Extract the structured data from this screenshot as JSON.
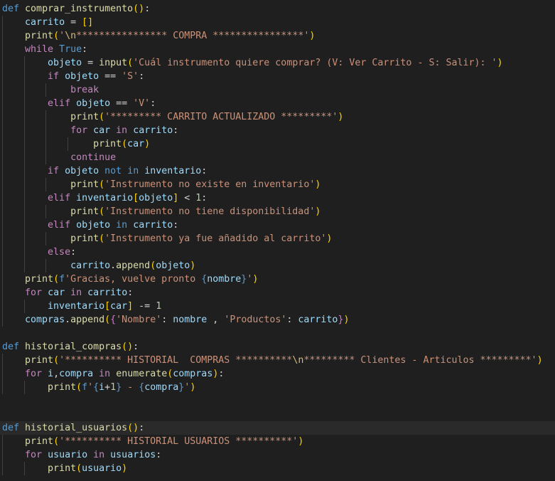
{
  "theme": {
    "background": "#1f1f1f",
    "current_line": "#2a2a2a",
    "indent_guide": "#404040",
    "colors": {
      "kw": "#569cd6",
      "ctl": "#c586c0",
      "fn": "#dcdcaa",
      "var": "#9cdcfe",
      "str": "#ce9178",
      "num": "#b5cea8",
      "op": "#d4d4d4",
      "b1": "#ffd700",
      "b2": "#da70d6",
      "b3": "#179fff",
      "esc": "#d7ba7d"
    }
  },
  "editor": {
    "lines": [
      {
        "indent": 0,
        "tokens": [
          [
            "def",
            "kw"
          ],
          [
            " ",
            "op"
          ],
          [
            "comprar_instrumento",
            "fn"
          ],
          [
            "(",
            "b1"
          ],
          [
            ")",
            "b1"
          ],
          [
            ":",
            "op"
          ]
        ]
      },
      {
        "indent": 1,
        "tokens": [
          [
            "carrito",
            "var"
          ],
          [
            " = ",
            "op"
          ],
          [
            "[",
            "b1"
          ],
          [
            "]",
            "b1"
          ]
        ]
      },
      {
        "indent": 1,
        "tokens": [
          [
            "print",
            "fn"
          ],
          [
            "(",
            "b1"
          ],
          [
            "'",
            "str"
          ],
          [
            "\\n",
            "esc"
          ],
          [
            "**************** COMPRA ****************'",
            "str"
          ],
          [
            ")",
            "b1"
          ]
        ]
      },
      {
        "indent": 1,
        "tokens": [
          [
            "while",
            "ctl"
          ],
          [
            " ",
            "op"
          ],
          [
            "True",
            "kw"
          ],
          [
            ":",
            "op"
          ]
        ]
      },
      {
        "indent": 2,
        "tokens": [
          [
            "objeto",
            "var"
          ],
          [
            " = ",
            "op"
          ],
          [
            "input",
            "fn"
          ],
          [
            "(",
            "b1"
          ],
          [
            "'Cuál instrumento quiere comprar? (V: Ver Carrito - S: Salir): '",
            "str"
          ],
          [
            ")",
            "b1"
          ]
        ]
      },
      {
        "indent": 2,
        "tokens": [
          [
            "if",
            "ctl"
          ],
          [
            " ",
            "op"
          ],
          [
            "objeto",
            "var"
          ],
          [
            " == ",
            "op"
          ],
          [
            "'S'",
            "str"
          ],
          [
            ":",
            "op"
          ]
        ]
      },
      {
        "indent": 3,
        "tokens": [
          [
            "break",
            "ctl"
          ]
        ]
      },
      {
        "indent": 2,
        "tokens": [
          [
            "elif",
            "ctl"
          ],
          [
            " ",
            "op"
          ],
          [
            "objeto",
            "var"
          ],
          [
            " == ",
            "op"
          ],
          [
            "'V'",
            "str"
          ],
          [
            ":",
            "op"
          ]
        ]
      },
      {
        "indent": 3,
        "tokens": [
          [
            "print",
            "fn"
          ],
          [
            "(",
            "b1"
          ],
          [
            "'********* CARRITO ACTUALIZADO *********'",
            "str"
          ],
          [
            ")",
            "b1"
          ]
        ]
      },
      {
        "indent": 3,
        "tokens": [
          [
            "for",
            "ctl"
          ],
          [
            " ",
            "op"
          ],
          [
            "car",
            "var"
          ],
          [
            " ",
            "op"
          ],
          [
            "in",
            "ctl"
          ],
          [
            " ",
            "op"
          ],
          [
            "carrito",
            "var"
          ],
          [
            ":",
            "op"
          ]
        ]
      },
      {
        "indent": 4,
        "tokens": [
          [
            "print",
            "fn"
          ],
          [
            "(",
            "b1"
          ],
          [
            "car",
            "var"
          ],
          [
            ")",
            "b1"
          ]
        ]
      },
      {
        "indent": 3,
        "tokens": [
          [
            "continue",
            "ctl"
          ]
        ]
      },
      {
        "indent": 2,
        "tokens": [
          [
            "if",
            "ctl"
          ],
          [
            " ",
            "op"
          ],
          [
            "objeto",
            "var"
          ],
          [
            " ",
            "op"
          ],
          [
            "not",
            "kw"
          ],
          [
            " ",
            "op"
          ],
          [
            "in",
            "kw"
          ],
          [
            " ",
            "op"
          ],
          [
            "inventario",
            "var"
          ],
          [
            ":",
            "op"
          ]
        ]
      },
      {
        "indent": 3,
        "tokens": [
          [
            "print",
            "fn"
          ],
          [
            "(",
            "b1"
          ],
          [
            "'Instrumento no existe en inventario'",
            "str"
          ],
          [
            ")",
            "b1"
          ]
        ]
      },
      {
        "indent": 2,
        "tokens": [
          [
            "elif",
            "ctl"
          ],
          [
            " ",
            "op"
          ],
          [
            "inventario",
            "var"
          ],
          [
            "[",
            "b1"
          ],
          [
            "objeto",
            "var"
          ],
          [
            "]",
            "b1"
          ],
          [
            " < ",
            "op"
          ],
          [
            "1",
            "num"
          ],
          [
            ":",
            "op"
          ]
        ]
      },
      {
        "indent": 3,
        "tokens": [
          [
            "print",
            "fn"
          ],
          [
            "(",
            "b1"
          ],
          [
            "'Instrumento no tiene disponibilidad'",
            "str"
          ],
          [
            ")",
            "b1"
          ]
        ]
      },
      {
        "indent": 2,
        "tokens": [
          [
            "elif",
            "ctl"
          ],
          [
            " ",
            "op"
          ],
          [
            "objeto",
            "var"
          ],
          [
            " ",
            "op"
          ],
          [
            "in",
            "kw"
          ],
          [
            " ",
            "op"
          ],
          [
            "carrito",
            "var"
          ],
          [
            ":",
            "op"
          ]
        ]
      },
      {
        "indent": 3,
        "tokens": [
          [
            "print",
            "fn"
          ],
          [
            "(",
            "b1"
          ],
          [
            "'Instrumento ya fue añadido al carrito'",
            "str"
          ],
          [
            ")",
            "b1"
          ]
        ]
      },
      {
        "indent": 2,
        "tokens": [
          [
            "else",
            "ctl"
          ],
          [
            ":",
            "op"
          ]
        ]
      },
      {
        "indent": 3,
        "tokens": [
          [
            "carrito",
            "var"
          ],
          [
            ".",
            "op"
          ],
          [
            "append",
            "fn"
          ],
          [
            "(",
            "b1"
          ],
          [
            "objeto",
            "var"
          ],
          [
            ")",
            "b1"
          ]
        ]
      },
      {
        "indent": 1,
        "tokens": [
          [
            "print",
            "fn"
          ],
          [
            "(",
            "b1"
          ],
          [
            "f",
            "kw"
          ],
          [
            "'Gracias, vuelve pronto ",
            "str"
          ],
          [
            "{",
            "kw"
          ],
          [
            "nombre",
            "var"
          ],
          [
            "}",
            "kw"
          ],
          [
            "'",
            "str"
          ],
          [
            ")",
            "b1"
          ]
        ]
      },
      {
        "indent": 1,
        "tokens": [
          [
            "for",
            "ctl"
          ],
          [
            " ",
            "op"
          ],
          [
            "car",
            "var"
          ],
          [
            " ",
            "op"
          ],
          [
            "in",
            "ctl"
          ],
          [
            " ",
            "op"
          ],
          [
            "carrito",
            "var"
          ],
          [
            ":",
            "op"
          ]
        ]
      },
      {
        "indent": 2,
        "tokens": [
          [
            "inventario",
            "var"
          ],
          [
            "[",
            "b1"
          ],
          [
            "car",
            "var"
          ],
          [
            "]",
            "b1"
          ],
          [
            " -= ",
            "op"
          ],
          [
            "1",
            "num"
          ]
        ]
      },
      {
        "indent": 1,
        "tokens": [
          [
            "compras",
            "var"
          ],
          [
            ".",
            "op"
          ],
          [
            "append",
            "fn"
          ],
          [
            "(",
            "b1"
          ],
          [
            "{",
            "b2"
          ],
          [
            "'Nombre'",
            "str"
          ],
          [
            ": ",
            "op"
          ],
          [
            "nombre",
            "var"
          ],
          [
            " , ",
            "op"
          ],
          [
            "'Productos'",
            "str"
          ],
          [
            ": ",
            "op"
          ],
          [
            "carrito",
            "var"
          ],
          [
            "}",
            "b2"
          ],
          [
            ")",
            "b1"
          ]
        ]
      },
      {
        "indent": 0,
        "tokens": []
      },
      {
        "indent": 0,
        "tokens": [
          [
            "def",
            "kw"
          ],
          [
            " ",
            "op"
          ],
          [
            "historial_compras",
            "fn"
          ],
          [
            "(",
            "b1"
          ],
          [
            ")",
            "b1"
          ],
          [
            ":",
            "op"
          ]
        ]
      },
      {
        "indent": 1,
        "tokens": [
          [
            "print",
            "fn"
          ],
          [
            "(",
            "b1"
          ],
          [
            "'********** HISTORIAL  COMPRAS **********",
            "str"
          ],
          [
            "\\n",
            "esc"
          ],
          [
            "********* Clientes - Articulos *********'",
            "str"
          ],
          [
            ")",
            "b1"
          ]
        ]
      },
      {
        "indent": 1,
        "tokens": [
          [
            "for",
            "ctl"
          ],
          [
            " ",
            "op"
          ],
          [
            "i",
            "var"
          ],
          [
            ",",
            "op"
          ],
          [
            "compra",
            "var"
          ],
          [
            " ",
            "op"
          ],
          [
            "in",
            "ctl"
          ],
          [
            " ",
            "op"
          ],
          [
            "enumerate",
            "fn"
          ],
          [
            "(",
            "b1"
          ],
          [
            "compras",
            "var"
          ],
          [
            ")",
            "b1"
          ],
          [
            ":",
            "op"
          ]
        ]
      },
      {
        "indent": 2,
        "tokens": [
          [
            "print",
            "fn"
          ],
          [
            "(",
            "b1"
          ],
          [
            "f",
            "kw"
          ],
          [
            "'",
            "str"
          ],
          [
            "{",
            "kw"
          ],
          [
            "i",
            "var"
          ],
          [
            "+",
            "op"
          ],
          [
            "1",
            "num"
          ],
          [
            "}",
            "kw"
          ],
          [
            " - ",
            "str"
          ],
          [
            "{",
            "kw"
          ],
          [
            "compra",
            "var"
          ],
          [
            "}",
            "kw"
          ],
          [
            "'",
            "str"
          ],
          [
            ")",
            "b1"
          ]
        ]
      },
      {
        "indent": 0,
        "tokens": []
      },
      {
        "indent": 0,
        "tokens": []
      },
      {
        "indent": 0,
        "highlight": true,
        "tokens": [
          [
            "def",
            "kw"
          ],
          [
            " ",
            "op"
          ],
          [
            "historial_usuarios",
            "fn"
          ],
          [
            "(",
            "b1"
          ],
          [
            ")",
            "b1"
          ],
          [
            ":",
            "op"
          ]
        ]
      },
      {
        "indent": 1,
        "tokens": [
          [
            "print",
            "fn"
          ],
          [
            "(",
            "b1"
          ],
          [
            "'********** HISTORIAL USUARIOS **********'",
            "str"
          ],
          [
            ")",
            "b1"
          ]
        ]
      },
      {
        "indent": 1,
        "tokens": [
          [
            "for",
            "ctl"
          ],
          [
            " ",
            "op"
          ],
          [
            "usuario",
            "var"
          ],
          [
            " ",
            "op"
          ],
          [
            "in",
            "ctl"
          ],
          [
            " ",
            "op"
          ],
          [
            "usuarios",
            "var"
          ],
          [
            ":",
            "op"
          ]
        ]
      },
      {
        "indent": 2,
        "tokens": [
          [
            "print",
            "fn"
          ],
          [
            "(",
            "b1"
          ],
          [
            "usuario",
            "var"
          ],
          [
            ")",
            "b1"
          ]
        ]
      }
    ]
  }
}
